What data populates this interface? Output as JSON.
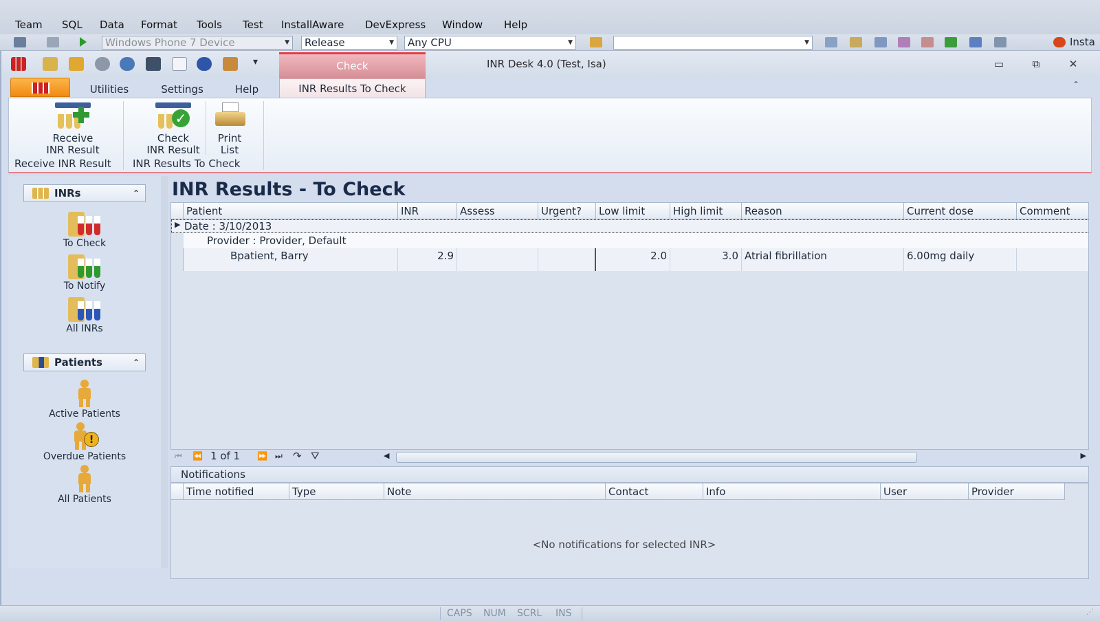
{
  "ide": {
    "menu": [
      "Team",
      "SQL",
      "Data",
      "Format",
      "Tools",
      "Test",
      "InstallAware",
      "DevExpress",
      "Window",
      "Help"
    ],
    "device_box": "Windows Phone 7 Device",
    "config_box": "Release",
    "platform_box": "Any CPU",
    "search_box": "",
    "installaware_label": "Insta"
  },
  "app": {
    "title": "INR Desk 4.0 (Test, Isa)",
    "context_tab": "Check",
    "tabs": [
      "Utilities",
      "Settings",
      "Help"
    ],
    "active_tab": "INR Results To Check",
    "ribbon": {
      "receive_button": [
        "Receive",
        "INR Result"
      ],
      "receive_group": "Receive INR Result",
      "check_button": [
        "Check",
        "INR Result"
      ],
      "print_button": [
        "Print",
        "List"
      ],
      "check_group": "INR Results To Check"
    }
  },
  "nav": {
    "inrs_header": "INRs",
    "inr_items": [
      "To Check",
      "To Notify",
      "All INRs"
    ],
    "patients_header": "Patients",
    "patient_items": [
      "Active Patients",
      "Overdue Patients",
      "All Patients"
    ]
  },
  "main": {
    "title": "INR Results - To Check",
    "columns": [
      "Patient",
      "INR",
      "Assess",
      "Urgent?",
      "Low limit",
      "High limit",
      "Reason",
      "Current dose",
      "Comment"
    ],
    "group_date": "Date : 3/10/2013",
    "group_provider": "Provider : Provider, Default",
    "row": {
      "patient": "Bpatient, Barry",
      "inr": "2.9",
      "assess": "",
      "urgent": "",
      "low": "2.0",
      "high": "3.0",
      "reason": "Atrial fibrillation",
      "dose": "6.00mg daily",
      "comment": ""
    },
    "pager": "1 of 1"
  },
  "notifications": {
    "title": "Notifications",
    "columns": [
      "Time notified",
      "Type",
      "Note",
      "Contact",
      "Info",
      "User",
      "Provider"
    ],
    "empty": "<No notifications for selected INR>"
  },
  "status": [
    "CAPS",
    "NUM",
    "SCRL",
    "INS"
  ]
}
